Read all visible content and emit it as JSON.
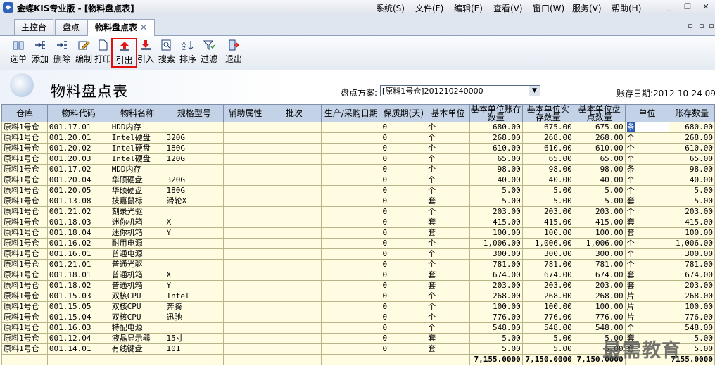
{
  "app": {
    "title": "金蝶KIS专业版 - [物料盘点表]",
    "icon": "app-logo-icon"
  },
  "menu": [
    "系统(S)",
    "文件(F)",
    "编辑(E)",
    "查看(V)",
    "窗口(W)",
    "服务(V)",
    "帮助(H)"
  ],
  "tabs": [
    "主控台",
    "盘点",
    "物料盘点表"
  ],
  "toolbar": [
    "选单",
    "添加",
    "删除",
    "编制",
    "打印",
    "引出",
    "引入",
    "搜索",
    "排序",
    "过滤",
    "退出"
  ],
  "page_title": "物料盘点表",
  "plan": {
    "label": "盘点方案:",
    "value": "[原料1号仓]201210240000"
  },
  "stock_date": "账存日期:2012-10-24 09:",
  "columns": [
    "仓库",
    "物料代码",
    "物料名称",
    "规格型号",
    "辅助属性",
    "批次",
    "生产/采购日期",
    "保质期(天)",
    "基本单位",
    "基本单位账存数量",
    "基本单位实存数量",
    "基本单位盘点数量",
    "单位",
    "账存数量"
  ],
  "rows": [
    [
      "原料1号仓",
      "001.17.01",
      "HDD内存",
      "",
      "",
      "",
      "",
      "0",
      "个",
      "680.00",
      "675.00",
      "675.00",
      "条",
      "680.00"
    ],
    [
      "原料1号仓",
      "001.20.01",
      "Intel硬盘",
      "320G",
      "",
      "",
      "",
      "0",
      "个",
      "268.00",
      "268.00",
      "268.00",
      "个",
      "268.00"
    ],
    [
      "原料1号仓",
      "001.20.02",
      "Intel硬盘",
      "180G",
      "",
      "",
      "",
      "0",
      "个",
      "610.00",
      "610.00",
      "610.00",
      "个",
      "610.00"
    ],
    [
      "原料1号仓",
      "001.20.03",
      "Intel硬盘",
      "120G",
      "",
      "",
      "",
      "0",
      "个",
      "65.00",
      "65.00",
      "65.00",
      "个",
      "65.00"
    ],
    [
      "原料1号仓",
      "001.17.02",
      "MDD内存",
      "",
      "",
      "",
      "",
      "0",
      "个",
      "98.00",
      "98.00",
      "98.00",
      "条",
      "98.00"
    ],
    [
      "原料1号仓",
      "001.20.04",
      "华硕硬盘",
      "320G",
      "",
      "",
      "",
      "0",
      "个",
      "40.00",
      "40.00",
      "40.00",
      "个",
      "40.00"
    ],
    [
      "原料1号仓",
      "001.20.05",
      "华硕硬盘",
      "180G",
      "",
      "",
      "",
      "0",
      "个",
      "5.00",
      "5.00",
      "5.00",
      "个",
      "5.00"
    ],
    [
      "原料1号仓",
      "001.13.08",
      "技嘉鼠标",
      "滑轮X",
      "",
      "",
      "",
      "0",
      "套",
      "5.00",
      "5.00",
      "5.00",
      "套",
      "5.00"
    ],
    [
      "原料1号仓",
      "001.21.02",
      "刻录光驱",
      "",
      "",
      "",
      "",
      "0",
      "个",
      "203.00",
      "203.00",
      "203.00",
      "个",
      "203.00"
    ],
    [
      "原料1号仓",
      "001.18.03",
      "迷你机箱",
      "X",
      "",
      "",
      "",
      "0",
      "套",
      "415.00",
      "415.00",
      "415.00",
      "套",
      "415.00"
    ],
    [
      "原料1号仓",
      "001.18.04",
      "迷你机箱",
      "Y",
      "",
      "",
      "",
      "0",
      "套",
      "100.00",
      "100.00",
      "100.00",
      "套",
      "100.00"
    ],
    [
      "原料1号仓",
      "001.16.02",
      "耐用电源",
      "",
      "",
      "",
      "",
      "0",
      "个",
      "1,006.00",
      "1,006.00",
      "1,006.00",
      "个",
      "1,006.00"
    ],
    [
      "原料1号仓",
      "001.16.01",
      "普通电源",
      "",
      "",
      "",
      "",
      "0",
      "个",
      "300.00",
      "300.00",
      "300.00",
      "个",
      "300.00"
    ],
    [
      "原料1号仓",
      "001.21.01",
      "普通光驱",
      "",
      "",
      "",
      "",
      "0",
      "个",
      "781.00",
      "781.00",
      "781.00",
      "个",
      "781.00"
    ],
    [
      "原料1号仓",
      "001.18.01",
      "普通机箱",
      "X",
      "",
      "",
      "",
      "0",
      "套",
      "674.00",
      "674.00",
      "674.00",
      "套",
      "674.00"
    ],
    [
      "原料1号仓",
      "001.18.02",
      "普通机箱",
      "Y",
      "",
      "",
      "",
      "0",
      "套",
      "203.00",
      "203.00",
      "203.00",
      "套",
      "203.00"
    ],
    [
      "原料1号仓",
      "001.15.03",
      "双核CPU",
      "Intel",
      "",
      "",
      "",
      "0",
      "个",
      "268.00",
      "268.00",
      "268.00",
      "片",
      "268.00"
    ],
    [
      "原料1号仓",
      "001.15.05",
      "双核CPU",
      "奔腾",
      "",
      "",
      "",
      "0",
      "个",
      "100.00",
      "100.00",
      "100.00",
      "片",
      "100.00"
    ],
    [
      "原料1号仓",
      "001.15.04",
      "双核CPU",
      "迅驰",
      "",
      "",
      "",
      "0",
      "个",
      "776.00",
      "776.00",
      "776.00",
      "片",
      "776.00"
    ],
    [
      "原料1号仓",
      "001.16.03",
      "特配电源",
      "",
      "",
      "",
      "",
      "0",
      "个",
      "548.00",
      "548.00",
      "548.00",
      "个",
      "548.00"
    ],
    [
      "原料1号仓",
      "001.12.04",
      "液晶显示器",
      "15寸",
      "",
      "",
      "",
      "0",
      "套",
      "5.00",
      "5.00",
      "5.00",
      "套",
      "5.00"
    ],
    [
      "原料1号仓",
      "001.14.01",
      "有线键盘",
      "101",
      "",
      "",
      "",
      "0",
      "套",
      "5.00",
      "5.00",
      "5.00",
      "套",
      "5.00"
    ]
  ],
  "totals": {
    "book": "7,155.0000",
    "actual": "7,150.0000",
    "count": "7,150.0000",
    "book2": "7155.0000"
  },
  "watermark": "最需教育"
}
